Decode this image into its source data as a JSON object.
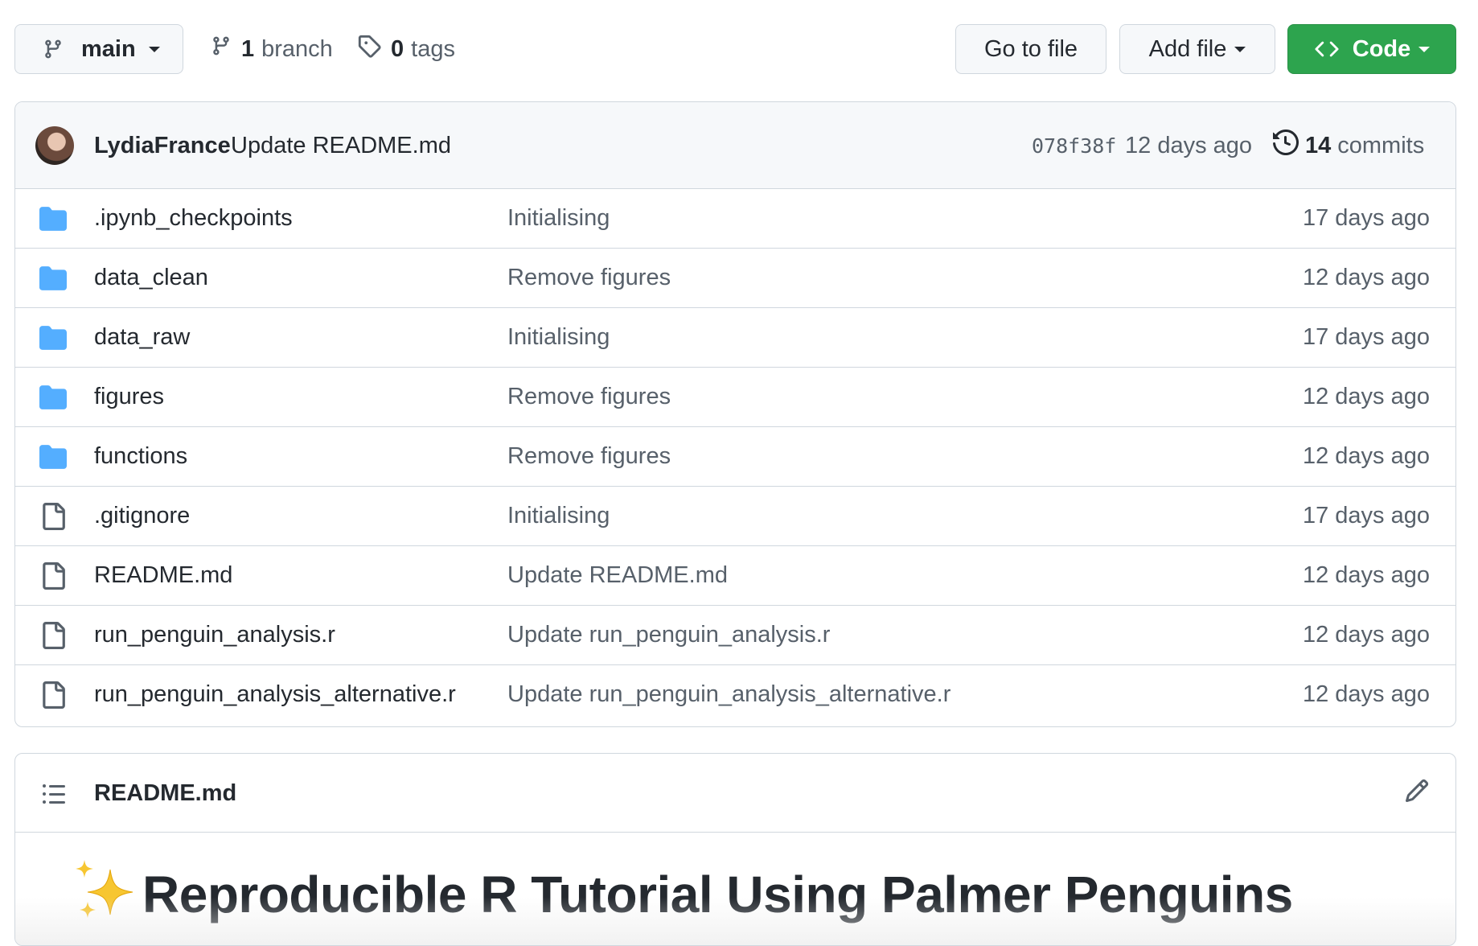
{
  "toolbar": {
    "branch_select": "main",
    "branch_count": "1",
    "branch_label": "branch",
    "tag_count": "0",
    "tag_label": "tags",
    "go_to_file": "Go to file",
    "add_file": "Add file",
    "code": "Code",
    "code_color": "#2da44e"
  },
  "latest_commit": {
    "author": "LydiaFrance",
    "message": "Update README.md",
    "sha": "078f38f",
    "age": "12 days ago",
    "commit_count": "14",
    "commit_label": "commits"
  },
  "files": [
    {
      "type": "folder",
      "name": ".ipynb_checkpoints",
      "message": "Initialising",
      "age": "17 days ago"
    },
    {
      "type": "folder",
      "name": "data_clean",
      "message": "Remove figures",
      "age": "12 days ago"
    },
    {
      "type": "folder",
      "name": "data_raw",
      "message": "Initialising",
      "age": "17 days ago"
    },
    {
      "type": "folder",
      "name": "figures",
      "message": "Remove figures",
      "age": "12 days ago"
    },
    {
      "type": "folder",
      "name": "functions",
      "message": "Remove figures",
      "age": "12 days ago"
    },
    {
      "type": "file",
      "name": ".gitignore",
      "message": "Initialising",
      "age": "17 days ago"
    },
    {
      "type": "file",
      "name": "README.md",
      "message": "Update README.md",
      "age": "12 days ago"
    },
    {
      "type": "file",
      "name": "run_penguin_analysis.r",
      "message": "Update run_penguin_analysis.r",
      "age": "12 days ago"
    },
    {
      "type": "file",
      "name": "run_penguin_analysis_alternative.r",
      "message": "Update run_penguin_analysis_alternative.r",
      "age": "12 days ago"
    }
  ],
  "readme": {
    "filename": "README.md",
    "heading": "Reproducible R Tutorial Using Palmer Penguins",
    "heading_emoji": "sparkles-icon"
  },
  "colors": {
    "folder": "#54aeff",
    "file_icon": "#57606a",
    "border": "#d0d7de",
    "header_bg": "#f6f8fa"
  }
}
